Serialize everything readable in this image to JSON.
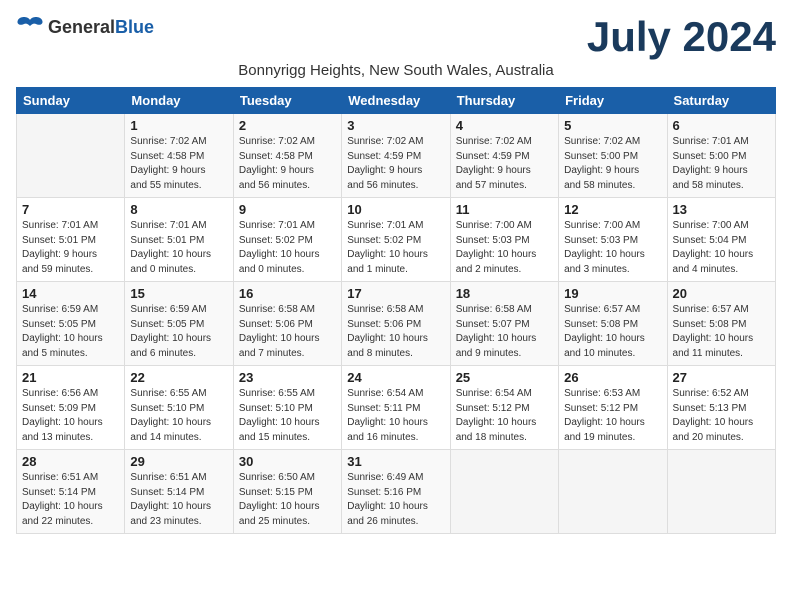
{
  "header": {
    "logo": {
      "general": "General",
      "blue": "Blue"
    },
    "month_title": "July 2024",
    "subtitle": "Bonnyrigg Heights, New South Wales, Australia"
  },
  "days_of_week": [
    "Sunday",
    "Monday",
    "Tuesday",
    "Wednesday",
    "Thursday",
    "Friday",
    "Saturday"
  ],
  "weeks": [
    [
      {
        "day": "",
        "info": ""
      },
      {
        "day": "1",
        "info": "Sunrise: 7:02 AM\nSunset: 4:58 PM\nDaylight: 9 hours\nand 55 minutes."
      },
      {
        "day": "2",
        "info": "Sunrise: 7:02 AM\nSunset: 4:58 PM\nDaylight: 9 hours\nand 56 minutes."
      },
      {
        "day": "3",
        "info": "Sunrise: 7:02 AM\nSunset: 4:59 PM\nDaylight: 9 hours\nand 56 minutes."
      },
      {
        "day": "4",
        "info": "Sunrise: 7:02 AM\nSunset: 4:59 PM\nDaylight: 9 hours\nand 57 minutes."
      },
      {
        "day": "5",
        "info": "Sunrise: 7:02 AM\nSunset: 5:00 PM\nDaylight: 9 hours\nand 58 minutes."
      },
      {
        "day": "6",
        "info": "Sunrise: 7:01 AM\nSunset: 5:00 PM\nDaylight: 9 hours\nand 58 minutes."
      }
    ],
    [
      {
        "day": "7",
        "info": "Sunrise: 7:01 AM\nSunset: 5:01 PM\nDaylight: 9 hours\nand 59 minutes."
      },
      {
        "day": "8",
        "info": "Sunrise: 7:01 AM\nSunset: 5:01 PM\nDaylight: 10 hours\nand 0 minutes."
      },
      {
        "day": "9",
        "info": "Sunrise: 7:01 AM\nSunset: 5:02 PM\nDaylight: 10 hours\nand 0 minutes."
      },
      {
        "day": "10",
        "info": "Sunrise: 7:01 AM\nSunset: 5:02 PM\nDaylight: 10 hours\nand 1 minute."
      },
      {
        "day": "11",
        "info": "Sunrise: 7:00 AM\nSunset: 5:03 PM\nDaylight: 10 hours\nand 2 minutes."
      },
      {
        "day": "12",
        "info": "Sunrise: 7:00 AM\nSunset: 5:03 PM\nDaylight: 10 hours\nand 3 minutes."
      },
      {
        "day": "13",
        "info": "Sunrise: 7:00 AM\nSunset: 5:04 PM\nDaylight: 10 hours\nand 4 minutes."
      }
    ],
    [
      {
        "day": "14",
        "info": "Sunrise: 6:59 AM\nSunset: 5:05 PM\nDaylight: 10 hours\nand 5 minutes."
      },
      {
        "day": "15",
        "info": "Sunrise: 6:59 AM\nSunset: 5:05 PM\nDaylight: 10 hours\nand 6 minutes."
      },
      {
        "day": "16",
        "info": "Sunrise: 6:58 AM\nSunset: 5:06 PM\nDaylight: 10 hours\nand 7 minutes."
      },
      {
        "day": "17",
        "info": "Sunrise: 6:58 AM\nSunset: 5:06 PM\nDaylight: 10 hours\nand 8 minutes."
      },
      {
        "day": "18",
        "info": "Sunrise: 6:58 AM\nSunset: 5:07 PM\nDaylight: 10 hours\nand 9 minutes."
      },
      {
        "day": "19",
        "info": "Sunrise: 6:57 AM\nSunset: 5:08 PM\nDaylight: 10 hours\nand 10 minutes."
      },
      {
        "day": "20",
        "info": "Sunrise: 6:57 AM\nSunset: 5:08 PM\nDaylight: 10 hours\nand 11 minutes."
      }
    ],
    [
      {
        "day": "21",
        "info": "Sunrise: 6:56 AM\nSunset: 5:09 PM\nDaylight: 10 hours\nand 13 minutes."
      },
      {
        "day": "22",
        "info": "Sunrise: 6:55 AM\nSunset: 5:10 PM\nDaylight: 10 hours\nand 14 minutes."
      },
      {
        "day": "23",
        "info": "Sunrise: 6:55 AM\nSunset: 5:10 PM\nDaylight: 10 hours\nand 15 minutes."
      },
      {
        "day": "24",
        "info": "Sunrise: 6:54 AM\nSunset: 5:11 PM\nDaylight: 10 hours\nand 16 minutes."
      },
      {
        "day": "25",
        "info": "Sunrise: 6:54 AM\nSunset: 5:12 PM\nDaylight: 10 hours\nand 18 minutes."
      },
      {
        "day": "26",
        "info": "Sunrise: 6:53 AM\nSunset: 5:12 PM\nDaylight: 10 hours\nand 19 minutes."
      },
      {
        "day": "27",
        "info": "Sunrise: 6:52 AM\nSunset: 5:13 PM\nDaylight: 10 hours\nand 20 minutes."
      }
    ],
    [
      {
        "day": "28",
        "info": "Sunrise: 6:51 AM\nSunset: 5:14 PM\nDaylight: 10 hours\nand 22 minutes."
      },
      {
        "day": "29",
        "info": "Sunrise: 6:51 AM\nSunset: 5:14 PM\nDaylight: 10 hours\nand 23 minutes."
      },
      {
        "day": "30",
        "info": "Sunrise: 6:50 AM\nSunset: 5:15 PM\nDaylight: 10 hours\nand 25 minutes."
      },
      {
        "day": "31",
        "info": "Sunrise: 6:49 AM\nSunset: 5:16 PM\nDaylight: 10 hours\nand 26 minutes."
      },
      {
        "day": "",
        "info": ""
      },
      {
        "day": "",
        "info": ""
      },
      {
        "day": "",
        "info": ""
      }
    ]
  ]
}
